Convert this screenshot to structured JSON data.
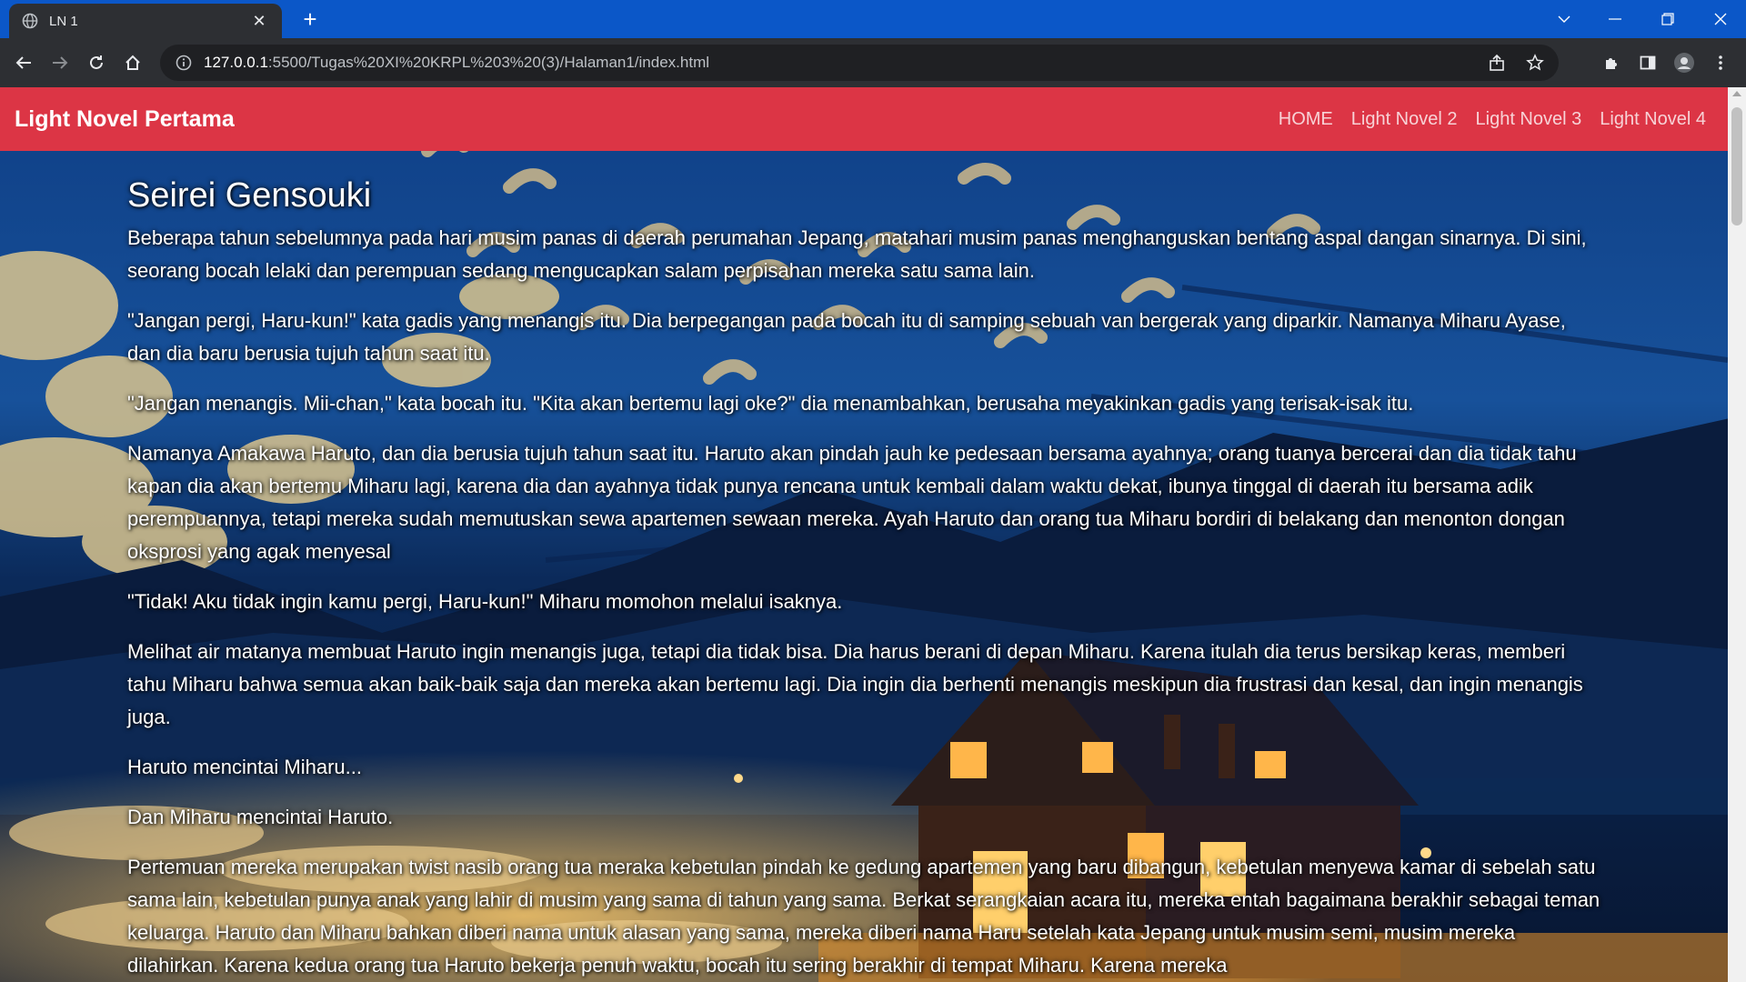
{
  "browser": {
    "tab_title": "LN 1",
    "url_host": "127.0.0.1",
    "url_rest": ":5500/Tugas%20XI%20KRPL%203%20(3)/Halaman1/index.html"
  },
  "navbar": {
    "brand": "Light Novel Pertama",
    "links": [
      "HOME",
      "Light Novel 2",
      "Light Novel 3",
      "Light Novel 4"
    ]
  },
  "article": {
    "title": "Seirei Gensouki",
    "paragraphs": [
      "Beberapa tahun sebelumnya pada hari musim panas di daerah perumahan Jepang, matahari musim panas menghanguskan bentang aspal dangan sinarnya. Di sini, seorang bocah lelaki dan perempuan sedang mengucapkan salam perpisahan mereka satu sama lain.",
      "\"Jangan pergi, Haru-kun!\" kata gadis yang menangis itu. Dia berpegangan pada bocah itu di samping sebuah van bergerak yang diparkir. Namanya Miharu Ayase, dan dia baru berusia tujuh tahun saat itu.",
      "\"Jangan menangis. Mii-chan,\" kata bocah itu. \"Kita akan bertemu lagi oke?\" dia menambahkan, berusaha meyakinkan gadis yang terisak-isak itu.",
      "Namanya Amakawa Haruto, dan dia berusia tujuh tahun saat itu. Haruto akan pindah jauh ke pedesaan bersama ayahnya; orang tuanya bercerai dan dia tidak tahu kapan dia akan bertemu Miharu lagi, karena dia dan ayahnya tidak punya rencana untuk kembali dalam waktu dekat, ibunya tinggal di daerah itu bersama adik perempuannya, tetapi mereka sudah memutuskan sewa apartemen sewaan mereka. Ayah Haruto dan orang tua Miharu bordiri di belakang dan menonton dongan oksprosi yang agak menyesal",
      "\"Tidak! Aku tidak ingin kamu pergi, Haru-kun!\" Miharu momohon melalui isaknya.",
      "Melihat air matanya membuat Haruto ingin menangis juga, tetapi dia tidak bisa. Dia harus berani di depan Miharu. Karena itulah dia terus bersikap keras, memberi tahu Miharu bahwa semua akan baik-baik saja dan mereka akan bertemu lagi. Dia ingin dia berhenti menangis meskipun dia frustrasi dan kesal, dan ingin menangis juga.",
      "Haruto mencintai Miharu...",
      "Dan Miharu mencintai Haruto.",
      "Pertemuan mereka merupakan twist nasib orang tua meraka kebetulan pindah ke gedung apartemen yang baru dibangun, kebetulan menyewa kamar di sebelah satu sama lain, kebetulan punya anak yang lahir di musim yang sama di tahun yang sama. Berkat serangkaian acara itu, mereka entah bagaimana berakhir sebagai teman keluarga. Haruto dan Miharu bahkan diberi nama untuk alasan yang sama, mereka diberi nama Haru setelah kata Jepang untuk musim semi, musim mereka dilahirkan. Karena kedua orang tua Haruto bekerja penuh waktu, bocah itu sering berakhir di tempat Miharu. Karena mereka"
    ]
  },
  "colors": {
    "navbar": "#dc3545",
    "tabstrip": "#0b57c8",
    "toolbar": "#2d2f33"
  }
}
